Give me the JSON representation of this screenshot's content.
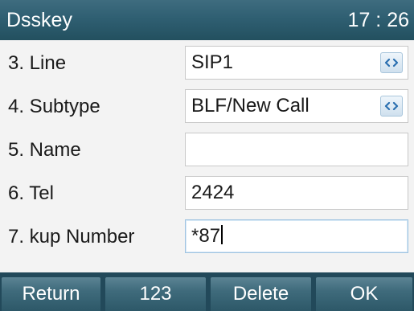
{
  "header": {
    "title": "Dsskey",
    "time": "17 : 26"
  },
  "rows": [
    {
      "label": "3. Line",
      "value": "SIP1",
      "has_spin": true
    },
    {
      "label": "4. Subtype",
      "value": "BLF/New Call",
      "has_spin": true
    },
    {
      "label": "5. Name",
      "value": "",
      "has_spin": false
    },
    {
      "label": "6. Tel",
      "value": "2424",
      "has_spin": false
    },
    {
      "label": "7. kup Number",
      "value": "*87",
      "has_spin": false,
      "active": true
    }
  ],
  "softkeys": [
    "Return",
    "123",
    "Delete",
    "OK"
  ],
  "icons": {
    "spin": "left-right-arrows-icon"
  },
  "colors": {
    "titlebar": "#2f5f72",
    "softkey": "#3f6b7c",
    "spin_arrows": "#2a6fb0"
  }
}
